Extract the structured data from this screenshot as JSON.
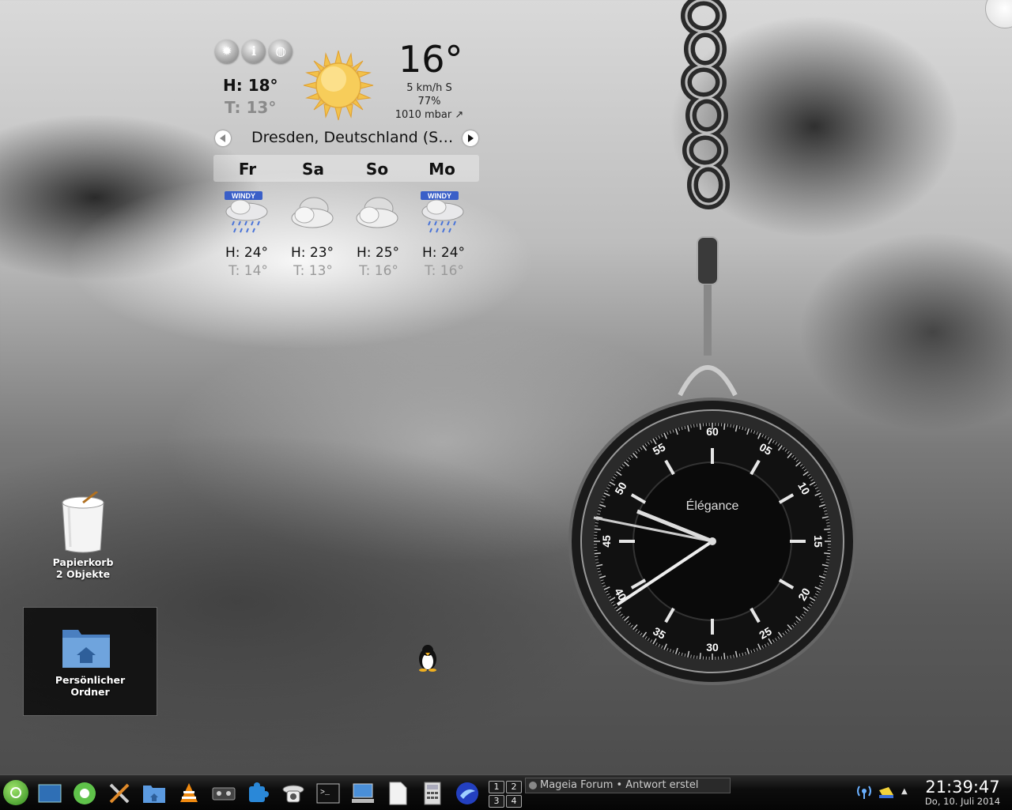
{
  "weather": {
    "today_high": "H: 18°",
    "today_low": "T: 13°",
    "current_temp": "16°",
    "wind": "5 km/h S",
    "humidity": "77%",
    "pressure": "1010 mbar ↗",
    "location": "Dresden, Deutschland (S…",
    "forecast": [
      {
        "day": "Fr",
        "high": "H: 24°",
        "low": "T: 14°",
        "icon": "rain-windy-icon",
        "badge": "WINDY"
      },
      {
        "day": "Sa",
        "high": "H: 23°",
        "low": "T: 13°",
        "icon": "cloudy-icon",
        "badge": ""
      },
      {
        "day": "So",
        "high": "H: 25°",
        "low": "T: 16°",
        "icon": "cloudy-icon",
        "badge": ""
      },
      {
        "day": "Mo",
        "high": "H: 24°",
        "low": "T: 16°",
        "icon": "rain-windy-icon",
        "badge": "WINDY"
      }
    ]
  },
  "clock_widget": {
    "brand": "Élégance",
    "dial_numbers": [
      "60",
      "05",
      "10",
      "15",
      "20",
      "25",
      "30",
      "35",
      "40",
      "45",
      "50",
      "55"
    ]
  },
  "desktop": {
    "trash_label": "Papierkorb",
    "trash_count": "2 Objekte",
    "home_label_1": "Persönlicher",
    "home_label_2": "Ordner"
  },
  "taskbar": {
    "pager": [
      "1",
      "2",
      "3",
      "4"
    ],
    "task_title": "Mageia Forum • Antwort erstel",
    "time": "21:39:47",
    "date": "Do, 10. Juli 2014"
  },
  "colors": {
    "taskbar_bg": "#0d0d0d",
    "clock_face": "#111111",
    "sun": "#f5c84a"
  }
}
